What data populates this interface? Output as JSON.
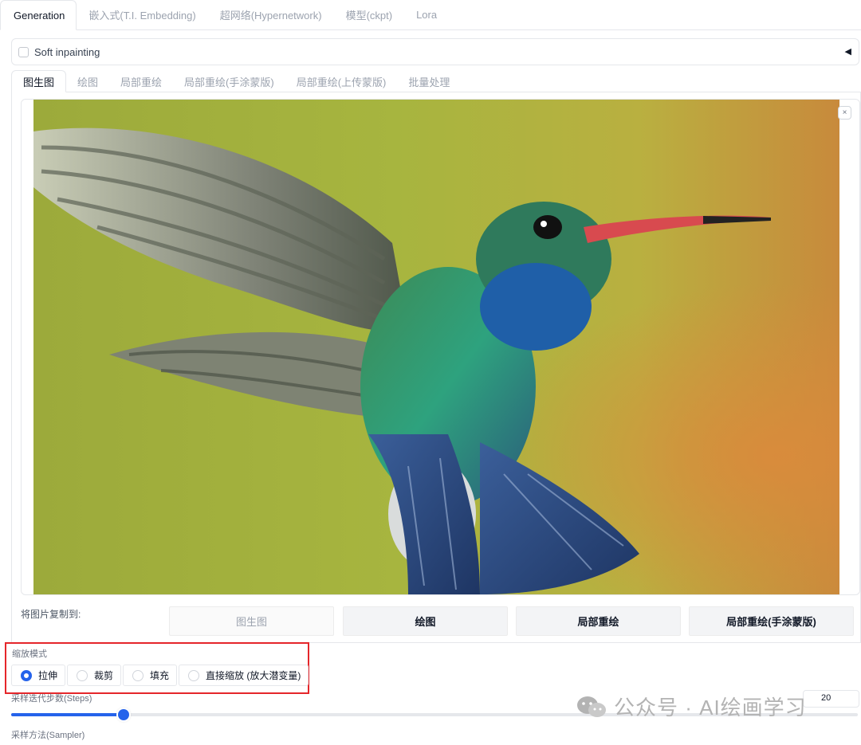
{
  "top_tabs": [
    {
      "label": "Generation",
      "active": true
    },
    {
      "label": "嵌入式(T.I. Embedding)",
      "active": false
    },
    {
      "label": "超网络(Hypernetwork)",
      "active": false
    },
    {
      "label": "模型(ckpt)",
      "active": false
    },
    {
      "label": "Lora",
      "active": false
    }
  ],
  "soft_inpainting": {
    "label": "Soft inpainting",
    "checked": false,
    "toggle_icon": "triangle-left-icon"
  },
  "sub_tabs": [
    {
      "label": "图生图",
      "active": true
    },
    {
      "label": "绘图",
      "active": false
    },
    {
      "label": "局部重绘",
      "active": false
    },
    {
      "label": "局部重绘(手涂蒙版)",
      "active": false
    },
    {
      "label": "局部重绘(上传蒙版)",
      "active": false
    },
    {
      "label": "批量处理",
      "active": false
    }
  ],
  "image": {
    "close_label": "×",
    "close_icon": "close-icon"
  },
  "copy_to": {
    "label": "将图片复制到:",
    "buttons": [
      "图生图",
      "绘图",
      "局部重绘",
      "局部重绘(手涂蒙版)"
    ]
  },
  "resize_mode": {
    "title": "缩放模式",
    "options": [
      "拉伸",
      "裁剪",
      "填充",
      "直接缩放 (放大潜变量)"
    ],
    "selected": "拉伸",
    "highlight_color": "#e5262a"
  },
  "steps": {
    "label": "采样迭代步数(Steps)",
    "value": "20",
    "fraction": 0.133
  },
  "sampler": {
    "label": "采样方法(Sampler)"
  },
  "watermark": {
    "text": "公众号 · AI绘画学习"
  },
  "colors": {
    "accent": "#2563eb"
  }
}
